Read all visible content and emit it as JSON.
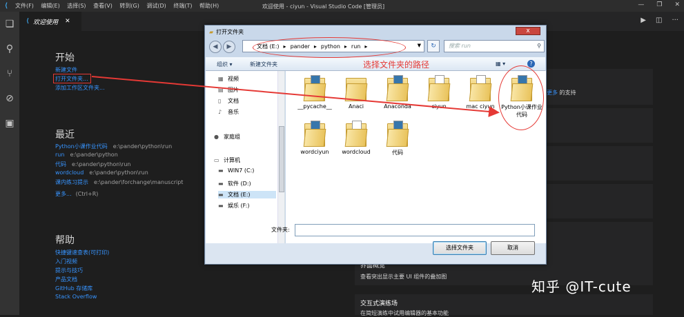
{
  "titlebar": {
    "menus": [
      "文件(F)",
      "编辑(E)",
      "选择(S)",
      "查看(V)",
      "转到(G)",
      "调试(D)",
      "终端(T)",
      "帮助(H)"
    ],
    "window_title": "欢迎使用 - ciyun - Visual Studio Code [管理员]"
  },
  "tab": {
    "label": "欢迎使用"
  },
  "welcome": {
    "start": {
      "heading": "开始",
      "new_file": "新建文件",
      "open_folder": "打开文件夹...",
      "add_folder": "添加工作区文件夹..."
    },
    "recent": {
      "heading": "最近",
      "items": [
        {
          "name": "Python小课作业代码",
          "path": "e:\\pander\\python\\run"
        },
        {
          "name": "run",
          "path": "e:\\pander\\python"
        },
        {
          "name": "代码",
          "path": "e:\\pander\\python\\run"
        },
        {
          "name": "wordcloud",
          "path": "e:\\pander\\python\\run"
        },
        {
          "name": "课内练习提示",
          "path": "e:\\pander\\forchange\\manuscript"
        }
      ],
      "more": "更多...",
      "more_hint": "(Ctrl+R)"
    },
    "help": {
      "heading": "帮助",
      "links": [
        "快捷键速查表(可打印)",
        "入门视频",
        "提示与技巧",
        "产品文档",
        "GitHub 存储库",
        "Stack Overflow"
      ]
    },
    "right": {
      "more_support": "更多",
      "support_suffix": "的支持",
      "ui_overview_title": "界面概览",
      "ui_overview_desc": "查看突出显示主要 UI 组件的叠加图",
      "playground_title": "交互式演练场",
      "playground_desc": "在简短演练中试用编辑器的基本功能"
    }
  },
  "dialog": {
    "title": "打开文件夹",
    "close": "x",
    "address": [
      "文档 (E:)",
      "pander",
      "python",
      "run"
    ],
    "search_placeholder": "搜索 run",
    "organize": "组织 ▾",
    "new_folder": "新建文件夹",
    "nav_items": [
      "视频",
      "图片",
      "文档",
      "音乐",
      "家庭组",
      "计算机",
      "WIN7 (C:)",
      "软件 (D:)",
      "文档 (E:)",
      "娱乐 (F:)"
    ],
    "files_row1": [
      "__pycache__",
      "Anaci",
      "Anaconda",
      "ciyun",
      "mac ciyun",
      "Python小课作业代码"
    ],
    "files_row2": [
      "wordciyun",
      "wordcloud",
      "代码"
    ],
    "folder_label": "文件夹:",
    "select_button": "选择文件夹",
    "cancel_button": "取消"
  },
  "annotation": {
    "text": "选择文件夹的路径"
  },
  "watermark": "知乎 @IT-cute",
  "colors": {
    "link": "#3794ff",
    "annotation": "#e53935",
    "vscode_bg": "#1e1e1e"
  }
}
